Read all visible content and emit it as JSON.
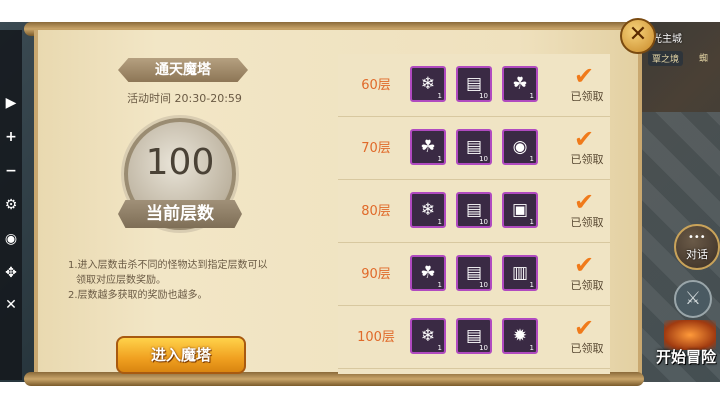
{
  "hud": {
    "city_label": "光主城",
    "area_label": "覃之境",
    "area_label2": "蜘",
    "chat_label": "对话",
    "adventure_label": "开始冒险"
  },
  "panel": {
    "title": "通天魔塔",
    "activity_time": "活动时间 20:30-20:59",
    "current_floor": "100",
    "current_floor_label": "当前层数",
    "rules": [
      "1.进入层数击杀不同的怪物达到指定层数可以",
      "领取对应层数奖励。",
      "2.层数越多获取的奖励也越多。"
    ],
    "enter_button": "进入魔塔",
    "claimed_text": "已领取",
    "rewards": [
      {
        "floor": "60层",
        "items": [
          {
            "icon": "blue-crystal-icon",
            "glyph": "❄",
            "count": "1"
          },
          {
            "icon": "red-book-icon",
            "glyph": "▤",
            "count": "10"
          },
          {
            "icon": "sprout-bag-icon",
            "glyph": "☘",
            "count": "1"
          }
        ]
      },
      {
        "floor": "70层",
        "items": [
          {
            "icon": "sprout-bag-icon",
            "glyph": "☘",
            "count": "1"
          },
          {
            "icon": "red-book-icon",
            "glyph": "▤",
            "count": "10"
          },
          {
            "icon": "green-orb-icon",
            "glyph": "◉",
            "count": "1"
          }
        ]
      },
      {
        "floor": "80层",
        "items": [
          {
            "icon": "blue-crystal-icon",
            "glyph": "❄",
            "count": "1"
          },
          {
            "icon": "red-book-icon",
            "glyph": "▤",
            "count": "10"
          },
          {
            "icon": "blue-scroll-icon",
            "glyph": "▣",
            "count": "1"
          }
        ]
      },
      {
        "floor": "90层",
        "items": [
          {
            "icon": "sprout-bag-icon",
            "glyph": "☘",
            "count": "1"
          },
          {
            "icon": "red-book-icon",
            "glyph": "▤",
            "count": "10"
          },
          {
            "icon": "orange-tome-icon",
            "glyph": "▥",
            "count": "1"
          }
        ]
      },
      {
        "floor": "100层",
        "items": [
          {
            "icon": "blue-crystal-icon",
            "glyph": "❄",
            "count": "1"
          },
          {
            "icon": "red-book-icon",
            "glyph": "▤",
            "count": "10"
          },
          {
            "icon": "fire-chest-icon",
            "glyph": "✹",
            "count": "1"
          }
        ]
      }
    ]
  },
  "toolbar": [
    "▶",
    "+",
    "−",
    "⚙",
    "◉",
    "✥",
    "✕"
  ],
  "colors": {
    "floor_text": "#e06a2a",
    "claimed_check": "#f07a1a",
    "enter_button": "#f0a020"
  }
}
